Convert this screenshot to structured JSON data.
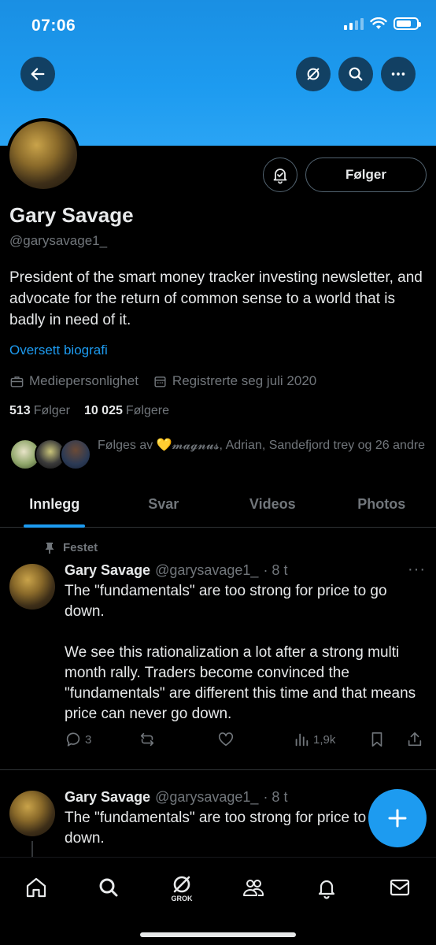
{
  "status_bar": {
    "time": "07:06"
  },
  "profile": {
    "follow_button_label": "Følger",
    "name": "Gary Savage",
    "handle": "@garysavage1_",
    "bio": "President of the smart money tracker investing newsletter, and advocate for the return of common sense to a world that is badly in need of it.",
    "translate_label": "Oversett biografi",
    "category": "Mediepersonlighet",
    "joined": "Registrerte seg juli 2020",
    "following_count": "513",
    "following_label": "Følger",
    "followers_count": "10 025",
    "followers_label": "Følgere",
    "followed_by_text": "Følges av 💛𝓶𝓪𝓰𝓷𝓾𝓼, Adrian, Sandefjord trey og 26 andre"
  },
  "tabs": [
    {
      "label": "Innlegg",
      "active": true
    },
    {
      "label": "Svar",
      "active": false
    },
    {
      "label": "Videos",
      "active": false
    },
    {
      "label": "Photos",
      "active": false
    }
  ],
  "posts": [
    {
      "pinned_label": "Festet",
      "author": "Gary Savage",
      "handle": "@garysavage1_",
      "time": "· 8 t",
      "text": "The \"fundamentals\" are too strong for price to go down.\n\nWe see this rationalization a lot after a strong multi month rally. Traders become convinced the \"fundamentals\" are different this time and that means price can never go down.",
      "replies": "3",
      "views": "1,9k"
    },
    {
      "author": "Gary Savage",
      "handle": "@garysavage1_",
      "time": "· 8 t",
      "text": "The \"fundamentals\" are too strong for price to go\ndown."
    }
  ],
  "bottom_nav": {
    "grok_label": "GROK"
  },
  "colors": {
    "accent": "#1d9bf0",
    "muted": "#71767b",
    "text": "#e7e9ea",
    "background": "#000000"
  },
  "icons": [
    "back-arrow-icon",
    "grok-icon",
    "search-icon",
    "more-icon",
    "bell-icon",
    "briefcase-icon",
    "calendar-icon",
    "pin-icon",
    "reply-icon",
    "repost-icon",
    "like-icon",
    "views-icon",
    "bookmark-icon",
    "share-icon",
    "plus-icon",
    "home-icon",
    "people-icon",
    "notifications-icon",
    "mail-icon"
  ]
}
